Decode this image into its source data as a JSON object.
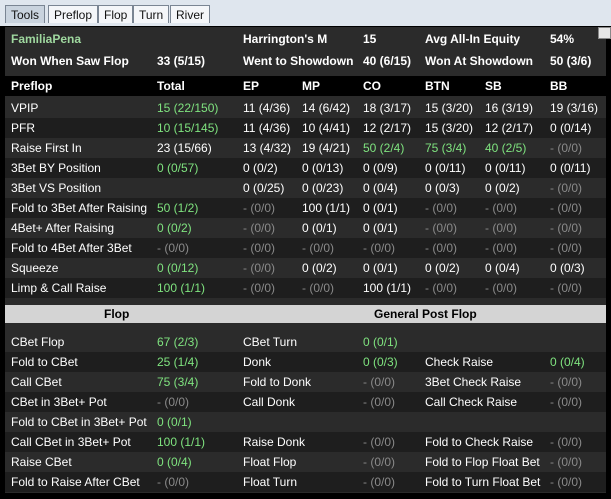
{
  "tabs": [
    "Tools",
    "Preflop",
    "Flop",
    "Turn",
    "River"
  ],
  "summary": {
    "player": "FamiliaPena",
    "hm_label": "Harrington's M",
    "hm_value": "15",
    "eq_label": "Avg All-In Equity",
    "eq_value": "54%",
    "wwsf_label": "Won When Saw Flop",
    "wwsf_value": "33 (5/15)",
    "wtsd_label": "Went to Showdown",
    "wtsd_value": "40 (6/15)",
    "wsd_label": "Won At Showdown",
    "wsd_value": "50 (3/6)"
  },
  "preflop": {
    "header": [
      "Preflop",
      "Total",
      "EP",
      "MP",
      "CO",
      "BTN",
      "SB",
      "BB"
    ],
    "rows": [
      {
        "stat": "VPIP",
        "cells": [
          [
            "15 (22/150)",
            "g"
          ],
          [
            "11 (4/36)",
            "w"
          ],
          [
            "14 (6/42)",
            "w"
          ],
          [
            "18 (3/17)",
            "w"
          ],
          [
            "15 (3/20)",
            "w"
          ],
          [
            "16 (3/19)",
            "w"
          ],
          [
            "19 (3/16)",
            "w"
          ]
        ]
      },
      {
        "stat": "PFR",
        "cells": [
          [
            "10 (15/145)",
            "g"
          ],
          [
            "11 (4/36)",
            "w"
          ],
          [
            "10 (4/41)",
            "w"
          ],
          [
            "12 (2/17)",
            "w"
          ],
          [
            "15 (3/20)",
            "w"
          ],
          [
            "12 (2/17)",
            "w"
          ],
          [
            "0 (0/14)",
            "w"
          ]
        ]
      },
      {
        "stat": "Raise First In",
        "cells": [
          [
            "23 (15/66)",
            "w"
          ],
          [
            "13 (4/32)",
            "w"
          ],
          [
            "19 (4/21)",
            "w"
          ],
          [
            "50 (2/4)",
            "g"
          ],
          [
            "75 (3/4)",
            "g"
          ],
          [
            "40 (2/5)",
            "g"
          ],
          [
            "- (0/0)",
            "d"
          ]
        ]
      },
      {
        "stat": "3Bet BY Position",
        "cells": [
          [
            "0 (0/57)",
            "g"
          ],
          [
            "0 (0/2)",
            "w"
          ],
          [
            "0 (0/13)",
            "w"
          ],
          [
            "0 (0/9)",
            "w"
          ],
          [
            "0 (0/11)",
            "w"
          ],
          [
            "0 (0/11)",
            "w"
          ],
          [
            "0 (0/11)",
            "w"
          ]
        ]
      },
      {
        "stat": "3Bet VS Position",
        "cells": [
          [
            "",
            ""
          ],
          [
            "0 (0/25)",
            "w"
          ],
          [
            "0 (0/23)",
            "w"
          ],
          [
            "0 (0/4)",
            "w"
          ],
          [
            "0 (0/3)",
            "w"
          ],
          [
            "0 (0/2)",
            "w"
          ],
          [
            "- (0/0)",
            "d"
          ]
        ]
      },
      {
        "stat": "Fold to 3Bet After Raising",
        "cells": [
          [
            "50 (1/2)",
            "g"
          ],
          [
            "- (0/0)",
            "d"
          ],
          [
            "100 (1/1)",
            "w"
          ],
          [
            "0 (0/1)",
            "w"
          ],
          [
            "- (0/0)",
            "d"
          ],
          [
            "- (0/0)",
            "d"
          ],
          [
            "- (0/0)",
            "d"
          ]
        ]
      },
      {
        "stat": "4Bet+ After Raising",
        "cells": [
          [
            "0 (0/2)",
            "g"
          ],
          [
            "- (0/0)",
            "d"
          ],
          [
            "0 (0/1)",
            "w"
          ],
          [
            "0 (0/1)",
            "w"
          ],
          [
            "- (0/0)",
            "d"
          ],
          [
            "- (0/0)",
            "d"
          ],
          [
            "- (0/0)",
            "d"
          ]
        ]
      },
      {
        "stat": "Fold to 4Bet After 3Bet",
        "cells": [
          [
            "- (0/0)",
            "d"
          ],
          [
            "- (0/0)",
            "d"
          ],
          [
            "- (0/0)",
            "d"
          ],
          [
            "- (0/0)",
            "d"
          ],
          [
            "- (0/0)",
            "d"
          ],
          [
            "- (0/0)",
            "d"
          ],
          [
            "- (0/0)",
            "d"
          ]
        ]
      },
      {
        "stat": "Squeeze",
        "cells": [
          [
            "0 (0/12)",
            "g"
          ],
          [
            "- (0/0)",
            "d"
          ],
          [
            "0 (0/2)",
            "w"
          ],
          [
            "0 (0/1)",
            "w"
          ],
          [
            "0 (0/2)",
            "w"
          ],
          [
            "0 (0/4)",
            "w"
          ],
          [
            "0 (0/3)",
            "w"
          ]
        ]
      },
      {
        "stat": "Limp & Call Raise",
        "cells": [
          [
            "100 (1/1)",
            "g"
          ],
          [
            "- (0/0)",
            "d"
          ],
          [
            "- (0/0)",
            "d"
          ],
          [
            "100 (1/1)",
            "w"
          ],
          [
            "- (0/0)",
            "d"
          ],
          [
            "- (0/0)",
            "d"
          ],
          [
            "- (0/0)",
            "d"
          ]
        ]
      }
    ]
  },
  "flop_title": "Flop",
  "post_title": "General Post Flop",
  "flop_rows": [
    [
      [
        "CBet Flop",
        "67 (2/3)",
        "g"
      ],
      [
        "CBet Turn",
        "0 (0/1)",
        "g"
      ],
      [
        "",
        "",
        " "
      ]
    ],
    [
      [
        "Fold to CBet",
        "25 (1/4)",
        "g"
      ],
      [
        "Donk",
        "0 (0/3)",
        "g"
      ],
      [
        "Check Raise",
        "0 (0/4)",
        "g"
      ]
    ],
    [
      [
        "Call CBet",
        "75 (3/4)",
        "g"
      ],
      [
        "Fold to Donk",
        "- (0/0)",
        "d"
      ],
      [
        "3Bet Check Raise",
        "- (0/0)",
        "d"
      ]
    ],
    [
      [
        "CBet in 3Bet+ Pot",
        "- (0/0)",
        "d"
      ],
      [
        "Call Donk",
        "- (0/0)",
        "d"
      ],
      [
        "Call Check Raise",
        "- (0/0)",
        "d"
      ]
    ],
    [
      [
        "Fold to CBet in 3Bet+ Pot",
        "0 (0/1)",
        "g"
      ],
      [
        "",
        "",
        ""
      ],
      [
        "",
        "",
        ""
      ]
    ],
    [
      [
        "Call CBet in 3Bet+ Pot",
        "100 (1/1)",
        "g"
      ],
      [
        "Raise Donk",
        "- (0/0)",
        "d"
      ],
      [
        "Fold to Check Raise",
        "- (0/0)",
        "d"
      ]
    ],
    [
      [
        "Raise CBet",
        "0 (0/4)",
        "g"
      ],
      [
        "Float Flop",
        "- (0/0)",
        "d"
      ],
      [
        "Fold to Flop Float Bet",
        "- (0/0)",
        "d"
      ]
    ],
    [
      [
        "Fold to Raise After CBet",
        "- (0/0)",
        "d"
      ],
      [
        "Float Turn",
        "- (0/0)",
        "d"
      ],
      [
        "Fold to Turn Float Bet",
        "- (0/0)",
        "d"
      ]
    ]
  ]
}
